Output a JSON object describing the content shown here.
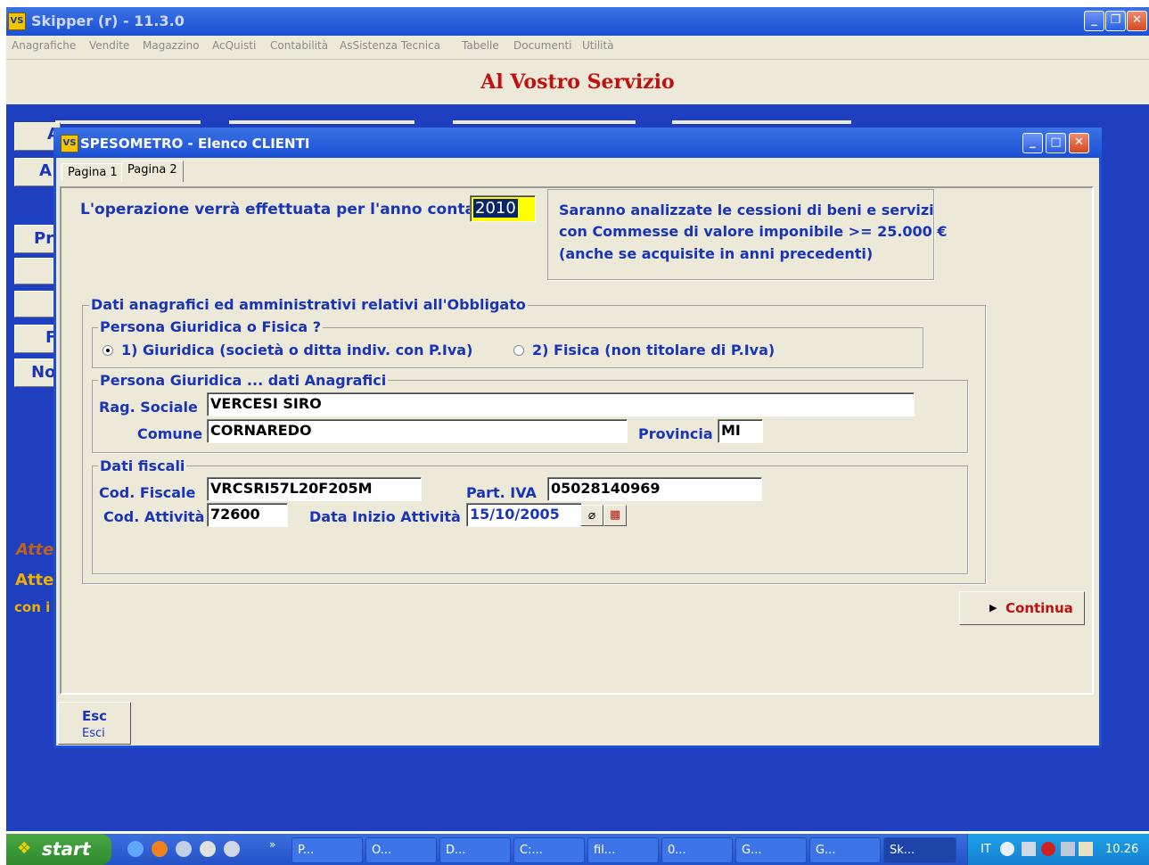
{
  "main_window": {
    "title": "Skipper (r) - 11.3.0",
    "menu": [
      "Anagrafiche",
      "Vendite",
      "Magazzino",
      "AcQuisti",
      "Contabilità",
      "AsSistenza Tecnica",
      "Tabelle",
      "Documenti",
      "Utilità"
    ],
    "banner": "Al Vostro Servizio",
    "bg_buttons": [
      "A",
      "A",
      "Pr",
      "F",
      "No"
    ],
    "bg_texts": [
      "Atte",
      "Atte",
      "con i"
    ]
  },
  "dialog": {
    "title": "SPESOMETRO - Elenco CLIENTI",
    "tabs": [
      "Pagina 1",
      "Pagina 2"
    ],
    "year_label": "L'operazione verrà effettuata per l'anno contabile",
    "year_value": "2010",
    "info_lines": [
      "Saranno analizzate le cessioni di beni e servizi",
      "con Commesse di valore imponibile >= 25.000 €",
      "(anche se acquisite in anni precedenti)"
    ],
    "group_obbligato": "Dati anagrafici ed amministrativi relativi all'Obbligato",
    "group_persona": "Persona Giuridica o Fisica ?",
    "radio_giuridica": "1) Giuridica (società o ditta indiv. con P.Iva)",
    "radio_fisica": "2) Fisica (non titolare di P.Iva)",
    "group_anagrafici": "Persona Giuridica ... dati Anagrafici",
    "rag_sociale_label": "Rag. Sociale",
    "rag_sociale_value": "VERCESI SIRO",
    "comune_label": "Comune",
    "comune_value": "CORNAREDO",
    "provincia_label": "Provincia",
    "provincia_value": "MI",
    "group_fiscali": "Dati fiscali",
    "cod_fiscale_label": "Cod. Fiscale",
    "cod_fiscale_value": "VRCSRI57L20F205M",
    "part_iva_label": "Part. IVA",
    "part_iva_value": "05028140969",
    "cod_attivita_label": "Cod. Attività",
    "cod_attivita_value": "72600",
    "data_inizio_label": "Data Inizio Attività",
    "data_inizio_value": "15/10/2005",
    "continua_label": "Continua",
    "esc_key": "Esc",
    "esc_label": "Esci"
  },
  "taskbar": {
    "start": "start",
    "items": [
      "P...",
      "O...",
      "D...",
      "C:...",
      "fil...",
      "0...",
      "G...",
      "G...",
      "Sk..."
    ],
    "lang": "IT",
    "clock": "10.26"
  }
}
